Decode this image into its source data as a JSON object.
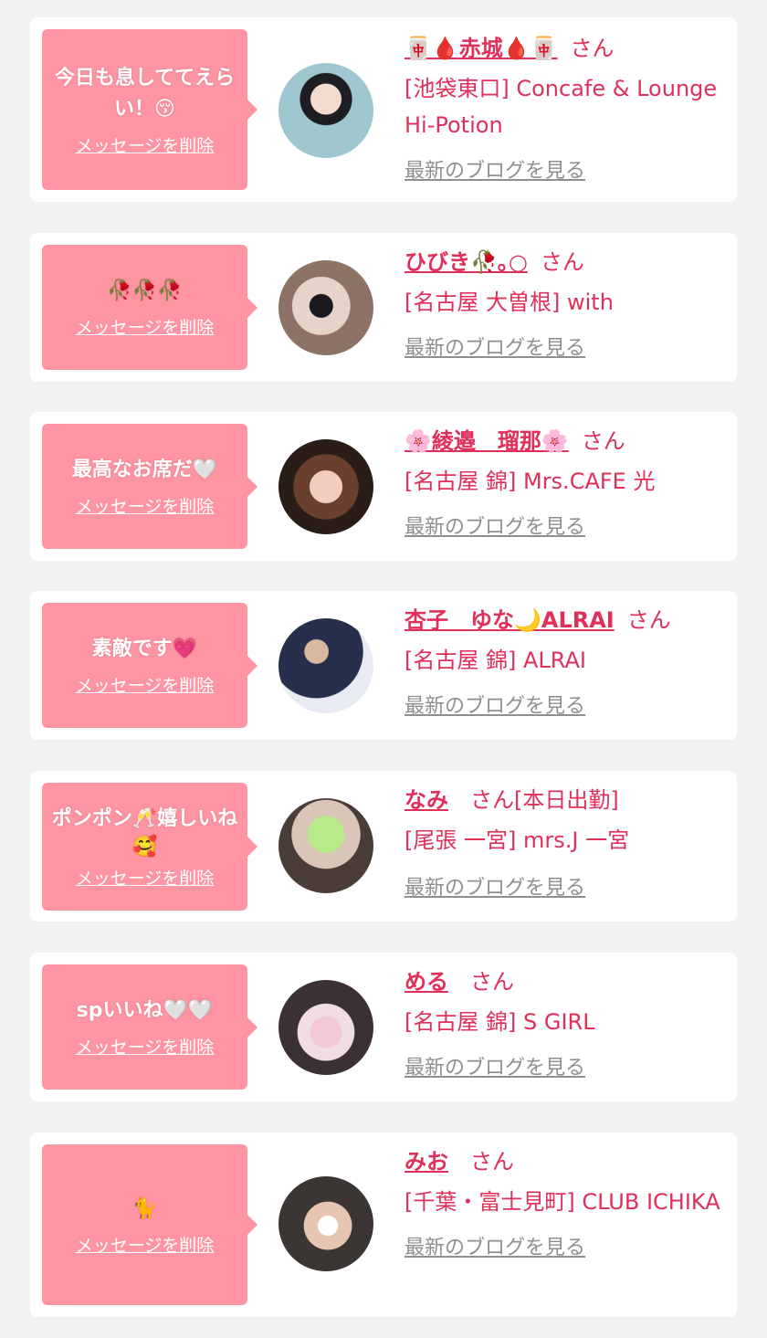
{
  "delete_label": "メッセージを削除",
  "blog_label": "最新のブログを見る",
  "san_label": "さん",
  "colors": {
    "bubble": "#ff95a3",
    "accent": "#e0305a",
    "link_gray": "#8f8f8f",
    "background": "#f2f2f3"
  },
  "cards": [
    {
      "message": "今日も息しててえらい！😚",
      "name": "🀄🩸赤城🩸🀄",
      "san": "さん",
      "status": "",
      "shop": "[池袋東口] Concafe & Lounge Hi-Potion",
      "avatar_icon": "avatar-photo"
    },
    {
      "message": "🥀🥀🥀",
      "name": "ひびき🥀｡○",
      "san": "さん",
      "status": "",
      "shop": "[名古屋 大曽根] with",
      "avatar_icon": "avatar-photo"
    },
    {
      "message": "最高なお席だ🤍",
      "name": "🌸綾邉　瑠那🌸",
      "san": "さん",
      "status": "",
      "shop": "[名古屋 錦] Mrs.CAFE 光",
      "avatar_icon": "avatar-photo"
    },
    {
      "message": "素敵です💗",
      "name": "杏子　ゆな🌙ALRAI",
      "san": "さん",
      "status": "",
      "shop": "[名古屋 錦] ALRAI",
      "avatar_icon": "avatar-photo"
    },
    {
      "message": "ポンポン🥂嬉しいね🥰",
      "name": "なみ",
      "san": "さん",
      "status": "[本日出勤]",
      "shop": "[尾張 一宮] mrs.J 一宮",
      "avatar_icon": "avatar-photo"
    },
    {
      "message": "spいいね🤍🤍",
      "name": "める",
      "san": "さん",
      "status": "",
      "shop": "[名古屋 錦] S GIRL",
      "avatar_icon": "avatar-photo"
    },
    {
      "message": "🐈",
      "name": "みお",
      "san": "さん",
      "status": "",
      "shop": "[千葉・富士見町] CLUB ICHIKA",
      "avatar_icon": "avatar-photo"
    }
  ]
}
